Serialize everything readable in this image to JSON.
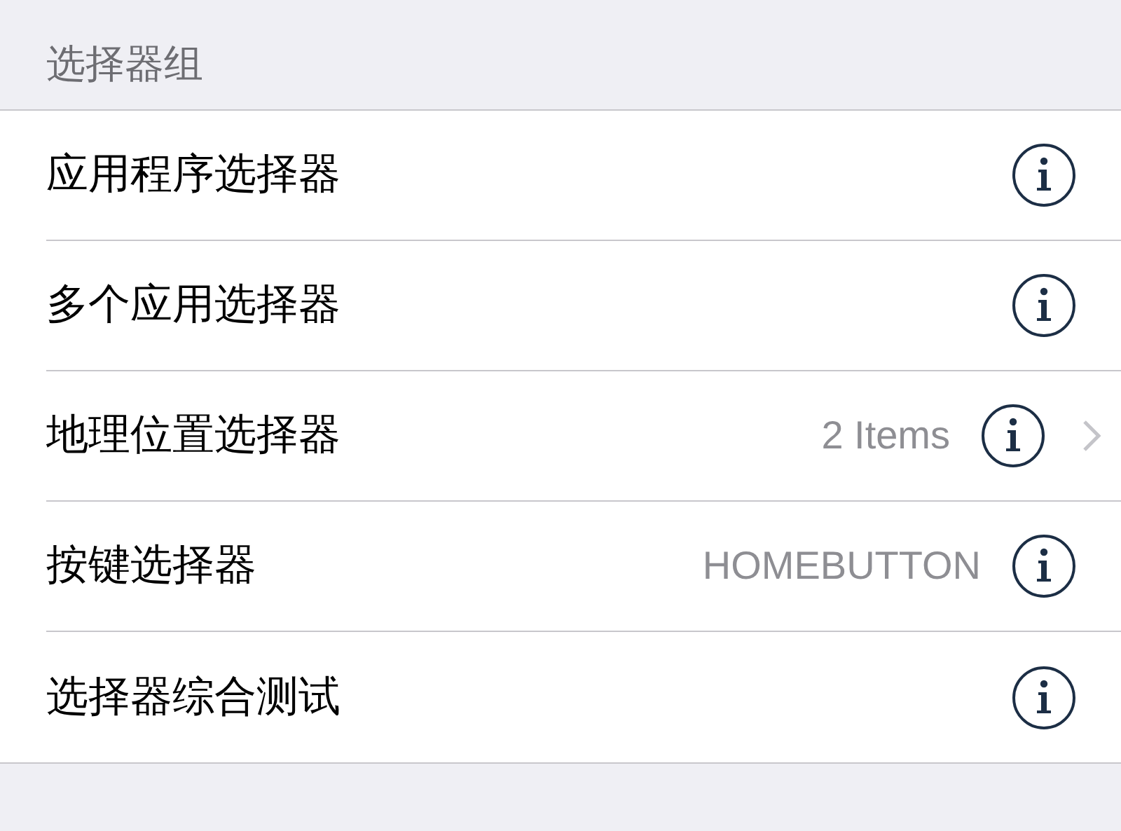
{
  "section": {
    "title": "选择器组"
  },
  "rows": [
    {
      "label": "应用程序选择器",
      "disclosure": false
    },
    {
      "label": "多个应用选择器",
      "disclosure": false
    },
    {
      "label": "地理位置选择器",
      "detail": "2 Items",
      "disclosure": true
    },
    {
      "label": "按键选择器",
      "detail": "HOMEBUTTON",
      "disclosure": false
    },
    {
      "label": "选择器综合测试",
      "disclosure": false
    }
  ]
}
